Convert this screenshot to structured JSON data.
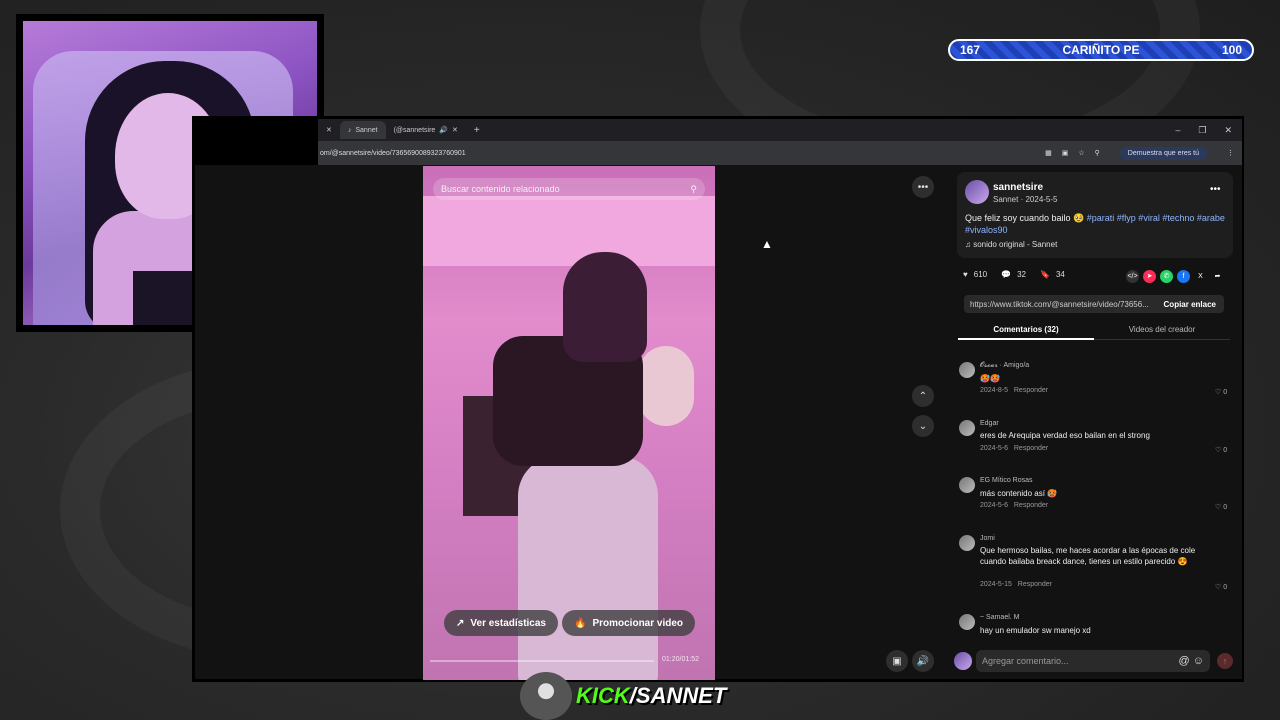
{
  "scorebar": {
    "left": "167",
    "title": "CARIÑITO PE",
    "right": "100"
  },
  "browser": {
    "tabs": [
      {
        "label": "Sannet"
      },
      {
        "label": "(@sannetsire"
      }
    ],
    "url": "om/@sannetsire/video/7365690089323760901",
    "verify_pill": "Demuestra que eres tú"
  },
  "video": {
    "search_placeholder": "Buscar contenido relacionado",
    "stats_button": "Ver estadísticas",
    "promote_button": "Promocionar video",
    "time": "01:20/01:52"
  },
  "post": {
    "username": "sannetsire",
    "display_name": "Sannet",
    "date": "2024-5-5",
    "caption_text": "Que feliz soy cuando bailo 🥹 ",
    "hashtags": "#parati #flyp #viral #techno #arabe #vivalos90",
    "sound": "sonido original - Sannet",
    "likes": "610",
    "comments": "32",
    "saves": "34",
    "link": "https://www.tiktok.com/@sannetsire/video/73656...",
    "copy_link": "Copiar enlace"
  },
  "tabs": {
    "comments": "Comentarios (32)",
    "creator_videos": "Videos del creador"
  },
  "comments": [
    {
      "name": "𝓞𝓼𝓬𝓪𝓻 · Amigo/a",
      "text": "🥵🥵",
      "date": "2024-8-5",
      "reply": "Responder",
      "likes": "0"
    },
    {
      "name": "Edgar",
      "text": "eres de Arequipa verdad eso bailan en el strong",
      "date": "2024-5-6",
      "reply": "Responder",
      "likes": "0"
    },
    {
      "name": "EG Mítico Rosas",
      "text": "más contenido así 🥵",
      "date": "2024-5-6",
      "reply": "Responder",
      "likes": "0"
    },
    {
      "name": "Jomi",
      "text": "Que hermoso bailas, me haces acordar a las épocas de cole cuando bailaba breack dance, tienes un estilo parecido 😍",
      "date": "2024-5-15",
      "reply": "Responder",
      "likes": "0"
    },
    {
      "name": "~ Samael. M",
      "text": "hay un emulador sw manejo xd",
      "date": "",
      "reply": "",
      "likes": ""
    }
  ],
  "add_comment_placeholder": "Agregar comentario...",
  "overlay": {
    "kick_brand": "KICK",
    "channel": "SANNET"
  },
  "colors": {
    "kick_green": "#53fc18",
    "hashtag_blue": "#8fb4ff",
    "scorebar_blue": "#2d54d6"
  }
}
